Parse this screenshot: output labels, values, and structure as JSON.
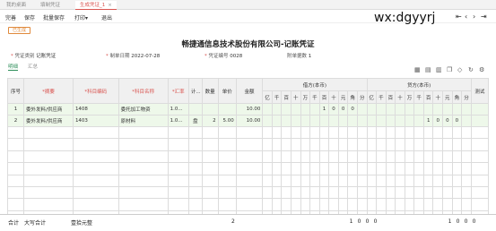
{
  "tabs": [
    {
      "label": "我的桌面",
      "active": false
    },
    {
      "label": "填制凭证",
      "active": false
    },
    {
      "label": "生成凭证_1",
      "active": true,
      "close": "×"
    }
  ],
  "toolbar": {
    "items": [
      "完善",
      "保存",
      "批量保存",
      "打印",
      "退出"
    ],
    "print_arrow": "▾"
  },
  "watermark": "wx:dgyyrj",
  "stamp": "已生成",
  "title": "畅捷通信息技术股份有限公司-记账凭证",
  "info": {
    "voucher_type_label": "凭证类别",
    "voucher_type_value": "记账凭证",
    "date_label": "制单日期",
    "date_value": "2022-07-28",
    "number_label": "凭证编号",
    "number_value": "0028",
    "attach_label": "附单据数",
    "attach_value": "1"
  },
  "subtabs": [
    "明细",
    "汇总"
  ],
  "table": {
    "headers": {
      "seq": "序号",
      "summary": "摘要",
      "code": "科目编码",
      "name": "科目名称",
      "rate": "汇率",
      "unit_m": "计...",
      "qty": "数量",
      "price": "单价",
      "amount": "金额",
      "debit": "借方(本币)",
      "credit": "贷方(本币)",
      "test": "测试"
    },
    "digit_labels": [
      "亿",
      "千",
      "百",
      "十",
      "万",
      "千",
      "百",
      "十",
      "元",
      "角",
      "分"
    ],
    "rows": [
      {
        "seq": "1",
        "summary": "委外发料/供应商",
        "code": "1408",
        "name": "委托加工物资",
        "rate": "1.0...",
        "unit": "",
        "qty": "",
        "price": "",
        "amount": "10.00",
        "debit": [
          "",
          "",
          "",
          "",
          "",
          "",
          "1",
          "0",
          "0",
          "0",
          ""
        ],
        "credit": [
          "",
          "",
          "",
          "",
          "",
          "",
          "",
          "",
          "",
          "",
          ""
        ]
      },
      {
        "seq": "2",
        "summary": "委外发料/供应商",
        "code": "1403",
        "name": "原材料",
        "rate": "1.0...",
        "unit": "盘",
        "qty": "2",
        "price": "5.00",
        "amount": "10.00",
        "debit": [
          "",
          "",
          "",
          "",
          "",
          "",
          "",
          "",
          "",
          "",
          ""
        ],
        "credit": [
          "",
          "",
          "",
          "",
          "",
          "",
          "1",
          "0",
          "0",
          "0",
          ""
        ]
      }
    ]
  },
  "footer": {
    "total_label": "合计",
    "upper_label": "大写合计",
    "upper_value": "壹拾元整",
    "qty_total": "2",
    "debit_total": [
      "1",
      "0",
      "0",
      "0"
    ],
    "credit_total": [
      "1",
      "0",
      "0",
      "0"
    ]
  }
}
